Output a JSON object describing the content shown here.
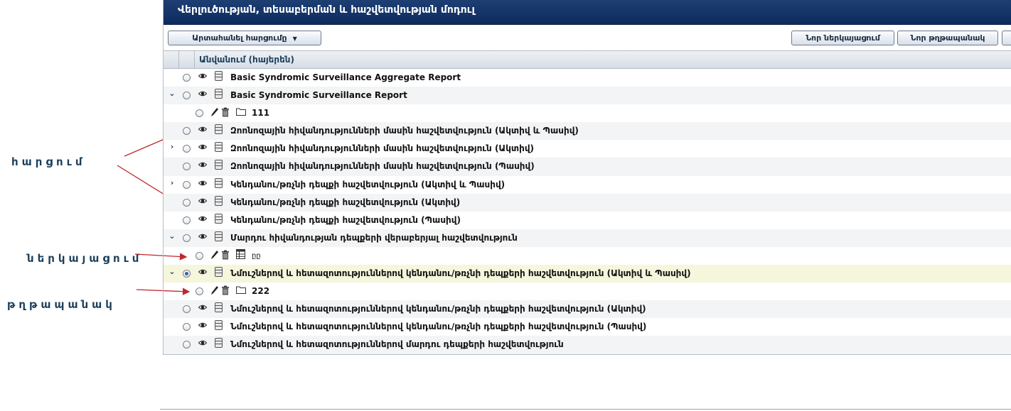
{
  "module": {
    "title": "Վերլուծության, տեսաբերման և հաշվետվության մոդուլ"
  },
  "toolbar": {
    "export_label": "Արտահանել հարցումը",
    "new_layout_label": "Նոր ներկայացում",
    "new_folder_label": "Նոր թղթապանակ"
  },
  "grid": {
    "header_name": "Անվանում (հայերեն)"
  },
  "rows": [
    {
      "type": "query",
      "label": "Basic Syndromic Surveillance Aggregate Report",
      "expander": ""
    },
    {
      "type": "query",
      "label": "Basic Syndromic Surveillance Report",
      "expander": "⌄"
    },
    {
      "type": "folder",
      "label": "111"
    },
    {
      "type": "query",
      "label": "Զոոնոզային հիվանդությունների մասին հաշվետվություն (Ակտիվ և Պասիվ)",
      "expander": ""
    },
    {
      "type": "query",
      "label": "Զոոնոզային հիվանդությունների մասին հաշվետվություն (Ակտիվ)",
      "expander": "›"
    },
    {
      "type": "query",
      "label": "Զոոնոզային հիվանդությունների մասին հաշվետվություն (Պասիվ)",
      "expander": ""
    },
    {
      "type": "query",
      "label": "Կենդանու/թռչնի դեպքի հաշվետվություն (Ակտիվ և Պասիվ)",
      "expander": "›"
    },
    {
      "type": "query",
      "label": "Կենդանու/թռչնի դեպքի հաշվետվություն (Ակտիվ)",
      "expander": ""
    },
    {
      "type": "query",
      "label": "Կենդանու/թռչնի դեպքի հաշվետվություն (Պասիվ)",
      "expander": ""
    },
    {
      "type": "query",
      "label": "Մարդու հիվանդության դեպքերի վերաբերյալ հաշվետվություն",
      "expander": "⌄"
    },
    {
      "type": "layout",
      "label": "ըը"
    },
    {
      "type": "query",
      "label": "Նմուշներով և հետազոտություններով կենդանու/թռչնի դեպքերի հաշվետվություն (Ակտիվ և Պասիվ)",
      "expander": "⌄",
      "selected": true
    },
    {
      "type": "folder",
      "label": "222"
    },
    {
      "type": "query",
      "label": "Նմուշներով և հետազոտություններով կենդանու/թռչնի դեպքերի հաշվետվություն (Ակտիվ)",
      "expander": ""
    },
    {
      "type": "query",
      "label": "Նմուշներով և հետազոտություններով կենդանու/թռչնի դեպքերի հաշվետվություն (Պասիվ)",
      "expander": ""
    },
    {
      "type": "query",
      "label": "Նմուշներով և հետազոտություններով մարդու դեպքերի հաշվետվություն",
      "expander": ""
    }
  ],
  "annotations": {
    "query": "հարցում",
    "layout": "ներկայացում",
    "folder": "թղթապանակ"
  },
  "colors": {
    "title_bar": "#0d2b5e",
    "arrow": "#c0282d",
    "annotation_text": "#1b3f5c",
    "selected_row": "#f5f6dc"
  }
}
